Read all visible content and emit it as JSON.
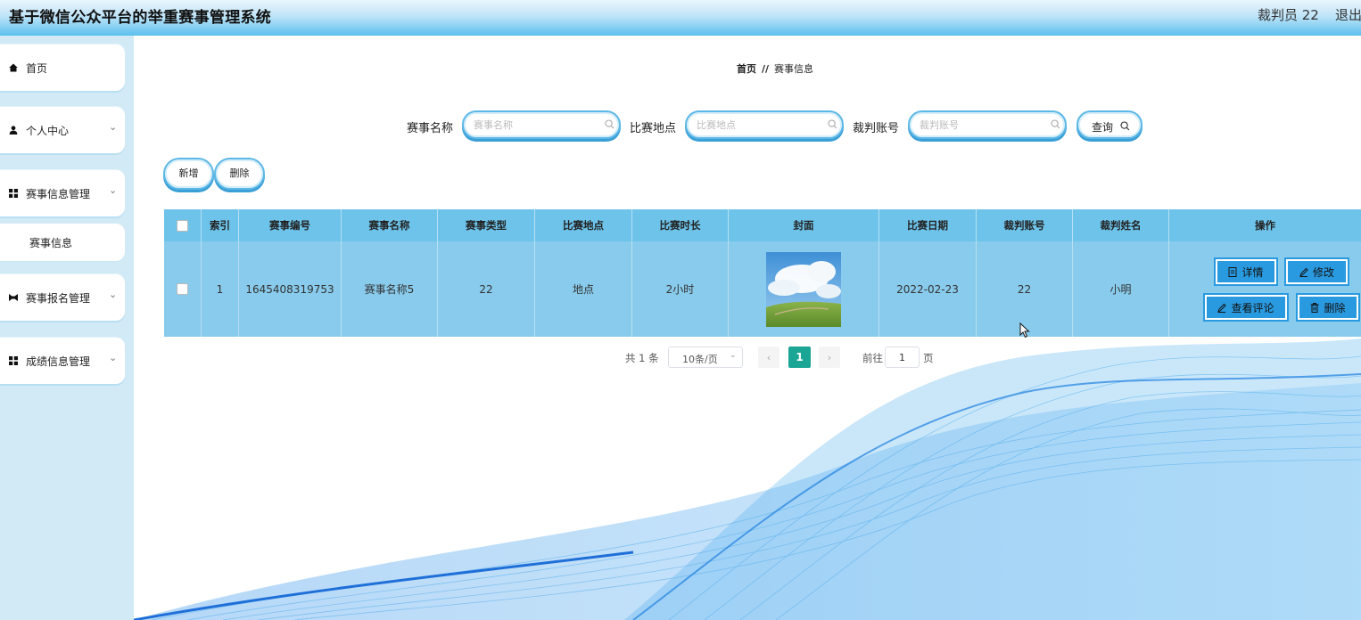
{
  "header": {
    "title": "基于微信公众平台的举重赛事管理系统",
    "user": "裁判员 22",
    "logout": "退出"
  },
  "sidebar": {
    "items": [
      {
        "label": "首页",
        "icon": "home-icon"
      },
      {
        "label": "个人中心",
        "icon": "user-icon"
      },
      {
        "label": "赛事信息管理",
        "icon": "grid-icon"
      },
      {
        "label": "赛事信息"
      },
      {
        "label": "赛事报名管理",
        "icon": "bowtie-icon"
      },
      {
        "label": "成绩信息管理",
        "icon": "grid-icon"
      }
    ]
  },
  "breadcrumb": {
    "home": "首页",
    "separator": "//",
    "current": "赛事信息"
  },
  "search": {
    "fields": [
      {
        "label": "赛事名称",
        "placeholder": "赛事名称"
      },
      {
        "label": "比赛地点",
        "placeholder": "比赛地点"
      },
      {
        "label": "裁判账号",
        "placeholder": "裁判账号"
      }
    ],
    "query_label": "查询"
  },
  "actions": {
    "add_label": "新增",
    "delete_label": "删除"
  },
  "table": {
    "columns": [
      "索引",
      "赛事编号",
      "赛事名称",
      "赛事类型",
      "比赛地点",
      "比赛时长",
      "封面",
      "比赛日期",
      "裁判账号",
      "裁判姓名",
      "操作"
    ],
    "rows": [
      {
        "index": "1",
        "code": "1645408319753",
        "name": "赛事名称5",
        "type": "22",
        "location": "地点",
        "duration": "2小时",
        "date": "2022-02-23",
        "referee_account": "22",
        "referee_name": "小明"
      }
    ],
    "row_actions": {
      "detail": "详情",
      "edit": "修改",
      "comments": "查看评论",
      "delete": "删除"
    }
  },
  "pagination": {
    "total": "共 1 条",
    "page_size": "10条/页",
    "current_page": "1",
    "goto_label": "前往",
    "goto_value": "1",
    "page_suffix": "页"
  },
  "colors": {
    "header_gradient_end": "#5cc0ee",
    "sidebar_bg": "#d2eaf6",
    "table_header": "#6dc3ea",
    "table_row": "#88cbec",
    "action_button": "#2a9ae0",
    "active_page": "#1aa594"
  }
}
